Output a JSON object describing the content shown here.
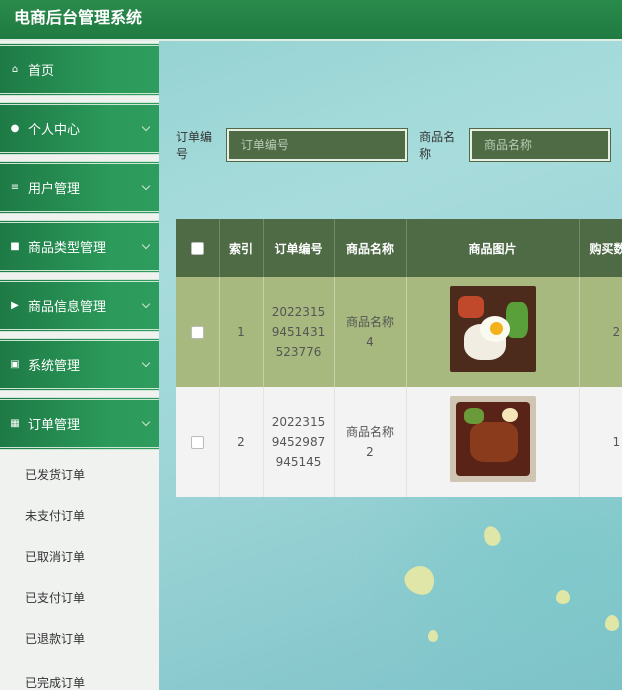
{
  "app": {
    "title": "电商后台管理系统"
  },
  "sidebar": {
    "items": [
      {
        "label": "首页",
        "icon": "home-icon",
        "glyph": "⌂"
      },
      {
        "label": "个人中心",
        "icon": "user-icon",
        "glyph": "●"
      },
      {
        "label": "用户管理",
        "icon": "list-icon",
        "glyph": "≡"
      },
      {
        "label": "商品类型管理",
        "icon": "briefcase-icon",
        "glyph": "■"
      },
      {
        "label": "商品信息管理",
        "icon": "flag-icon",
        "glyph": "▶"
      },
      {
        "label": "系统管理",
        "icon": "clipboard-icon",
        "glyph": "▣"
      },
      {
        "label": "订单管理",
        "icon": "grid-icon",
        "glyph": "▦"
      }
    ],
    "submenu": [
      {
        "label": "已发货订单"
      },
      {
        "label": "未支付订单"
      },
      {
        "label": "已取消订单"
      },
      {
        "label": "已支付订单"
      },
      {
        "label": "已退款订单"
      },
      {
        "label": "已完成订单"
      }
    ]
  },
  "search": {
    "order_no_label": "订单编号",
    "order_no_placeholder": "订单编号",
    "product_name_label": "商品名称",
    "product_name_placeholder": "商品名称"
  },
  "table": {
    "columns": [
      "索引",
      "订单编号",
      "商品名称",
      "商品图片",
      "购买数"
    ],
    "rows": [
      {
        "index": "1",
        "order_no": "2022315945143152377 6",
        "order_no_lines": [
          "2022315",
          "9451431",
          "523776"
        ],
        "product_lines": [
          "商品名称",
          "4"
        ],
        "quantity": "2",
        "image": "food-photo-1"
      },
      {
        "index": "2",
        "order_no_lines": [
          "2022315",
          "9452987",
          "945145"
        ],
        "product_lines": [
          "商品名称",
          "2"
        ],
        "quantity": "1",
        "image": "food-photo-2"
      }
    ]
  },
  "colors": {
    "header_green": "#1f7a40",
    "table_header": "#4e6b46",
    "row_highlight": "#a7b97e"
  }
}
